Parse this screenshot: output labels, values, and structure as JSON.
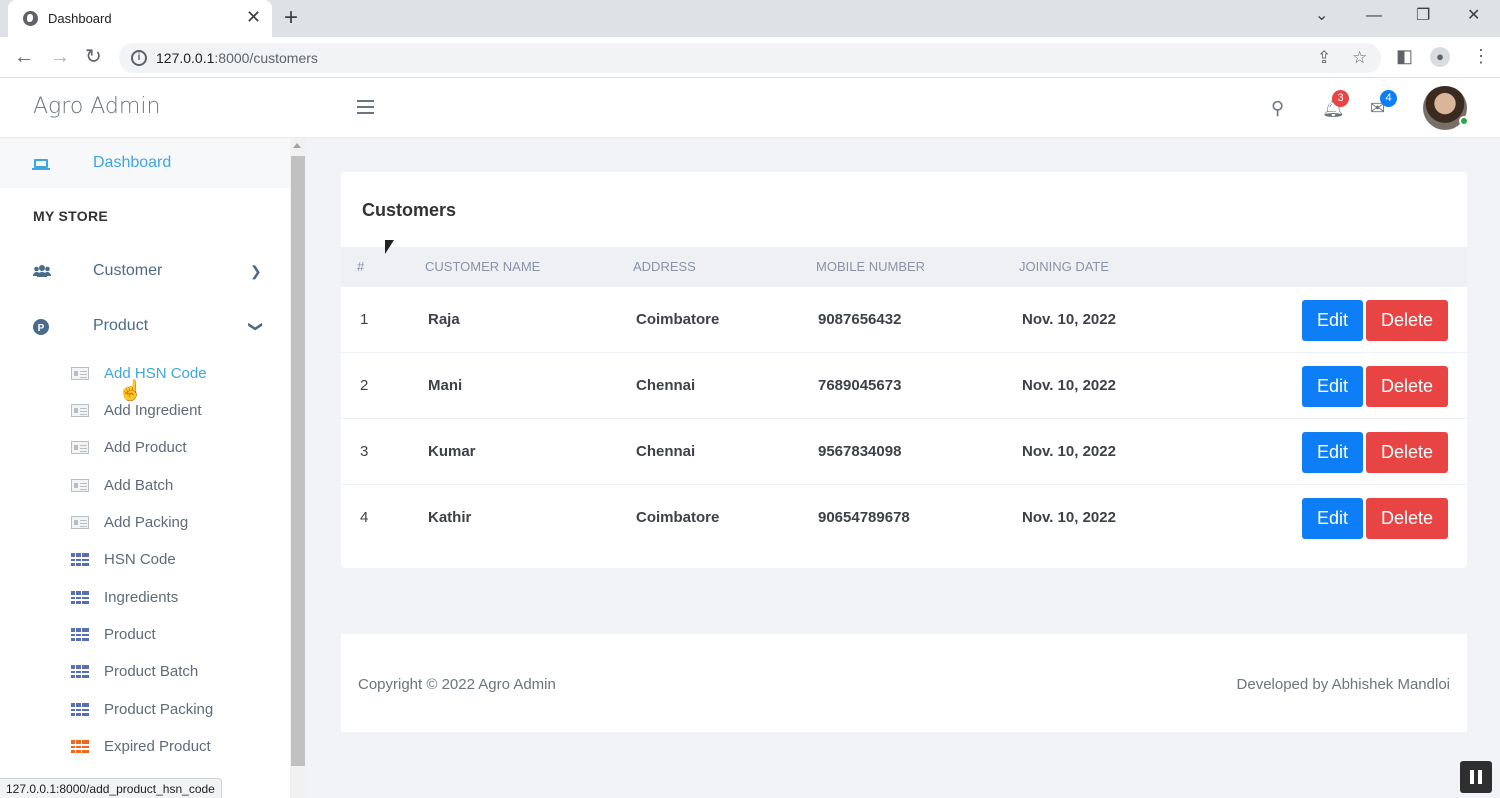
{
  "browser": {
    "tab_title": "Dashboard",
    "url_host": "127.0.0.1",
    "url_path": ":8000/customers",
    "status_url": "127.0.0.1:8000/add_product_hsn_code"
  },
  "header": {
    "brand": "Agro Admin",
    "notifications_count": "3",
    "messages_count": "4",
    "notifications_badge_color": "#e84444",
    "messages_badge_color": "#0d7ef5"
  },
  "sidebar": {
    "dashboard_label": "Dashboard",
    "section_heading": "MY STORE",
    "customer_label": "Customer",
    "product_label": "Product",
    "submenu": [
      {
        "label": "Add HSN Code",
        "icon": "card-icon"
      },
      {
        "label": "Add Ingredient",
        "icon": "card-icon"
      },
      {
        "label": "Add Product",
        "icon": "card-icon"
      },
      {
        "label": "Add Batch",
        "icon": "card-icon"
      },
      {
        "label": "Add Packing",
        "icon": "card-icon"
      },
      {
        "label": "HSN Code",
        "icon": "grid-icon"
      },
      {
        "label": "Ingredients",
        "icon": "grid-icon"
      },
      {
        "label": "Product",
        "icon": "grid-icon"
      },
      {
        "label": "Product Batch",
        "icon": "grid-icon"
      },
      {
        "label": "Product Packing",
        "icon": "grid-icon"
      },
      {
        "label": "Expired Product",
        "icon": "grid-icon-orange"
      }
    ]
  },
  "customers": {
    "title": "Customers",
    "columns": [
      "#",
      "CUSTOMER NAME",
      "ADDRESS",
      "MOBILE NUMBER",
      "JOINING DATE"
    ],
    "rows": [
      {
        "id": "1",
        "name": "Raja",
        "address": "Coimbatore",
        "mobile": "9087656432",
        "joined": "Nov. 10, 2022"
      },
      {
        "id": "2",
        "name": "Mani",
        "address": "Chennai",
        "mobile": "7689045673",
        "joined": "Nov. 10, 2022"
      },
      {
        "id": "3",
        "name": "Kumar",
        "address": "Chennai",
        "mobile": "9567834098",
        "joined": "Nov. 10, 2022"
      },
      {
        "id": "4",
        "name": "Kathir",
        "address": "Coimbatore",
        "mobile": "90654789678",
        "joined": "Nov. 10, 2022"
      }
    ],
    "edit_label": "Edit",
    "delete_label": "Delete"
  },
  "footer": {
    "left": "Copyright © 2022 Agro Admin",
    "right": "Developed by Abhishek Mandloi"
  }
}
